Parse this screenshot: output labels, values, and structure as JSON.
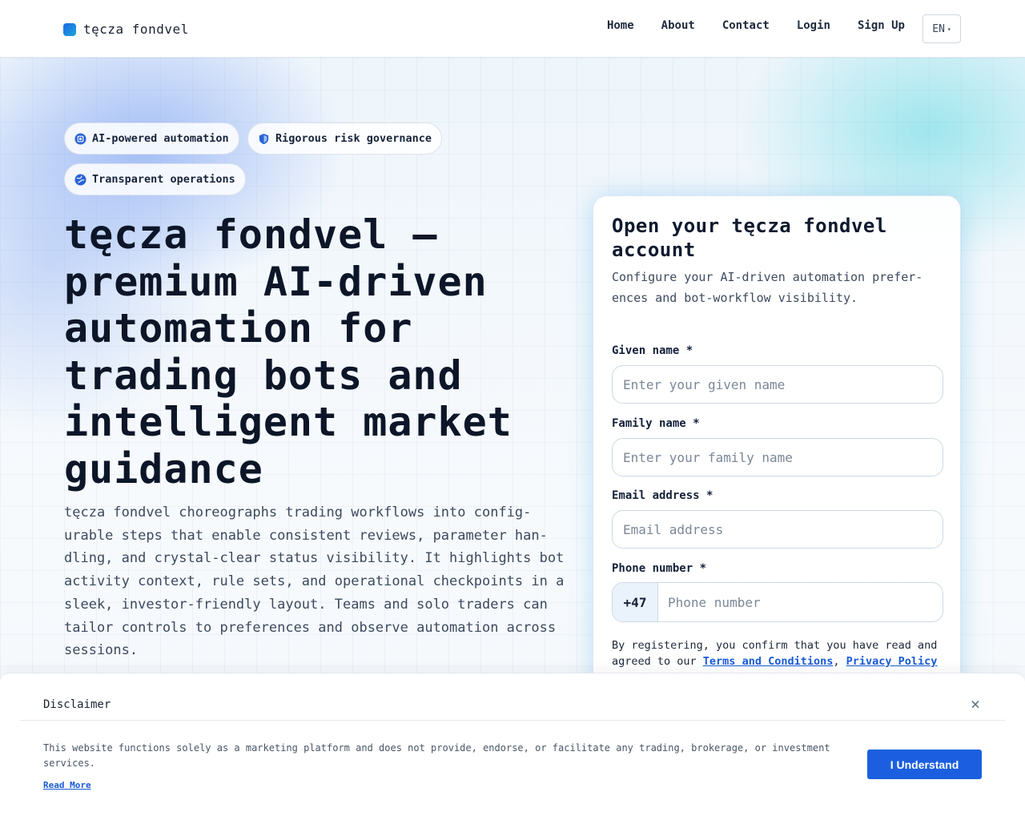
{
  "header": {
    "brand": "tęcza fondvel",
    "nav": [
      "Home",
      "About",
      "Contact",
      "Login",
      "Sign Up"
    ],
    "language": "EN"
  },
  "chips": [
    {
      "label": "AI-powered automation",
      "icon": "chip-icon"
    },
    {
      "label": "Rigorous risk governance",
      "icon": "shield-icon"
    },
    {
      "label": "Transparent operations",
      "icon": "globe-icon"
    }
  ],
  "hero": {
    "title": "tęcza fondvel — premium AI-driven automation for trading bots and intelligent market guidance",
    "text": "tęcza fondvel choreographs trading workflows into config-urable steps that enable consistent reviews, parameter han-dling, and crystal-clear status visibility. It highlights bot activity context, rule sets, and operational checkpoints in a sleek, investor-friendly layout. Teams and solo traders can tailor controls to preferences and observe automation across sessions."
  },
  "form": {
    "title": "Open your tęcza fondvel account",
    "subtitle": "Configure your AI-driven automation prefer-ences and bot-workflow visibility.",
    "given_name": {
      "label": "Given name *",
      "placeholder": "Enter your given name"
    },
    "family_name": {
      "label": "Family name *",
      "placeholder": "Enter your family name"
    },
    "email": {
      "label": "Email address *",
      "placeholder": "Email address"
    },
    "phone": {
      "label": "Phone number *",
      "prefix": "+47",
      "placeholder": "Phone number"
    },
    "consent_prefix": "By registering, you confirm that you have read and agreed to our ",
    "terms_link": "Terms and Conditions",
    "consent_sep": ", ",
    "privacy_link": "Privacy Policy"
  },
  "disclaimer": {
    "title": "Disclaimer",
    "text": "This website functions solely as a marketing platform and does not provide, endorse, or facilitate any trading, brokerage, or investment services.",
    "read_more": "Read More",
    "button": "I Understand"
  },
  "colors": {
    "accent": "#1b5fe0",
    "link": "#1a5bd6",
    "background": "#f4f8fc"
  }
}
